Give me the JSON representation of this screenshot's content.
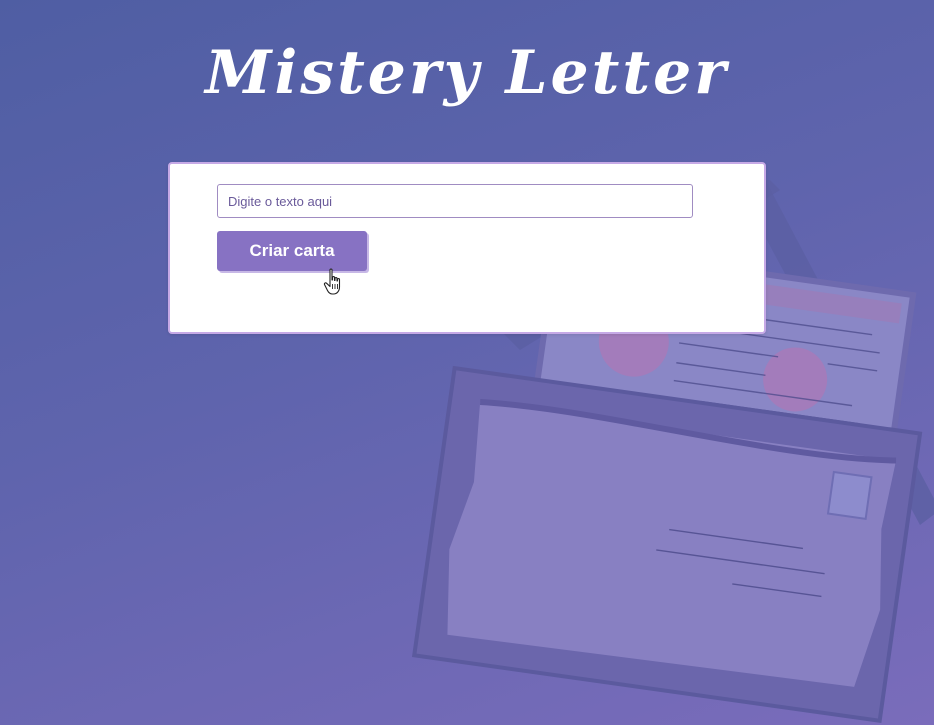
{
  "header": {
    "title": "Mistery Letter"
  },
  "form": {
    "input_placeholder": "Digite o texto aqui",
    "input_value": "",
    "button_label": "Criar carta"
  },
  "theme": {
    "background_start": "#4f5ea3",
    "background_end": "#7a6cbb",
    "card_border": "#c6a9e6",
    "button_color": "#8772c3"
  },
  "icons": {
    "cursor": "hand-pointer-icon",
    "background": "envelope-letter-illustration"
  }
}
